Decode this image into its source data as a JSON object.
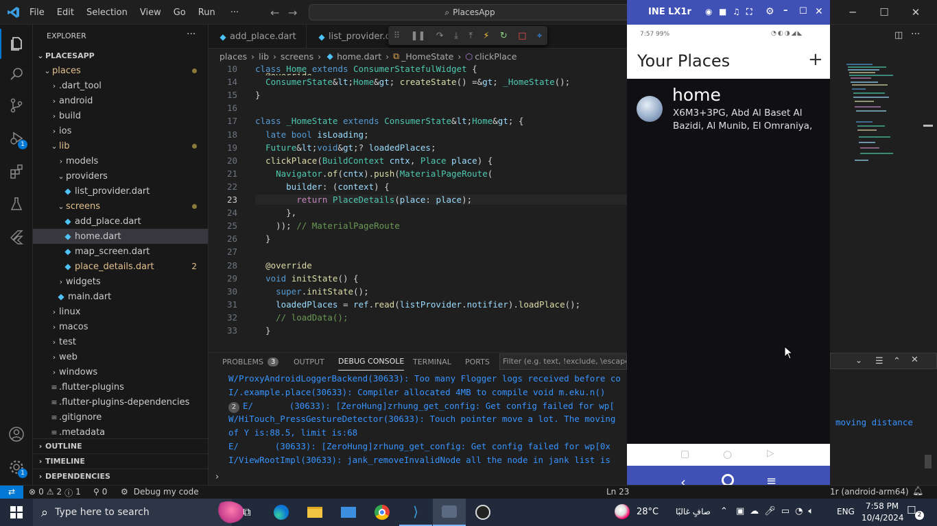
{
  "titlebar": {
    "menus": [
      "File",
      "Edit",
      "Selection",
      "View",
      "Go",
      "Run",
      "···"
    ],
    "search": "PlacesApp"
  },
  "explorer": {
    "title": "EXPLORER",
    "project": "PLACESAPP",
    "tree": [
      {
        "label": "places",
        "kind": "folder-open",
        "depth": 1,
        "color": "#e2c08d",
        "dot": true
      },
      {
        "label": ".dart_tool",
        "kind": "folder",
        "depth": 2
      },
      {
        "label": "android",
        "kind": "folder",
        "depth": 2
      },
      {
        "label": "build",
        "kind": "folder",
        "depth": 2
      },
      {
        "label": "ios",
        "kind": "folder",
        "depth": 2
      },
      {
        "label": "lib",
        "kind": "folder-open",
        "depth": 2,
        "color": "#e2c08d",
        "dot": true
      },
      {
        "label": "models",
        "kind": "folder",
        "depth": 3
      },
      {
        "label": "providers",
        "kind": "folder-open",
        "depth": 3
      },
      {
        "label": "list_provider.dart",
        "kind": "dart",
        "depth": 4
      },
      {
        "label": "screens",
        "kind": "folder-open",
        "depth": 3,
        "color": "#e2c08d",
        "dot": true
      },
      {
        "label": "add_place.dart",
        "kind": "dart",
        "depth": 4
      },
      {
        "label": "home.dart",
        "kind": "dart",
        "depth": 4,
        "selected": true
      },
      {
        "label": "map_screen.dart",
        "kind": "dart",
        "depth": 4
      },
      {
        "label": "place_details.dart",
        "kind": "dart",
        "depth": 4,
        "color": "#e2c08d",
        "badge": "2"
      },
      {
        "label": "widgets",
        "kind": "folder",
        "depth": 3
      },
      {
        "label": "main.dart",
        "kind": "dart",
        "depth": 3
      },
      {
        "label": "linux",
        "kind": "folder",
        "depth": 2
      },
      {
        "label": "macos",
        "kind": "folder",
        "depth": 2
      },
      {
        "label": "test",
        "kind": "folder",
        "depth": 2
      },
      {
        "label": "web",
        "kind": "folder",
        "depth": 2
      },
      {
        "label": "windows",
        "kind": "folder",
        "depth": 2
      },
      {
        "label": ".flutter-plugins",
        "kind": "file",
        "depth": 2
      },
      {
        "label": ".flutter-plugins-dependencies",
        "kind": "file",
        "depth": 2
      },
      {
        "label": ".gitignore",
        "kind": "file",
        "depth": 2
      },
      {
        "label": ".metadata",
        "kind": "file",
        "depth": 2
      }
    ],
    "sections": [
      "OUTLINE",
      "TIMELINE",
      "DEPENDENCIES"
    ]
  },
  "editor": {
    "tabs": [
      "add_place.dart",
      "list_provider.da"
    ],
    "breadcrumb": [
      "places",
      "lib",
      "screens",
      "home.dart",
      "_HomeState",
      "clickPlace"
    ],
    "current_line": "23",
    "lines": [
      {
        "n": "10",
        "t": "class Home extends ConsumerStatefulWidget {"
      },
      {
        "n": "14",
        "t": "  ConsumerState<Home> createState() => _HomeState();"
      },
      {
        "n": "15",
        "t": "}"
      },
      {
        "n": "16",
        "t": ""
      },
      {
        "n": "17",
        "t": "class _HomeState extends ConsumerState<Home> {"
      },
      {
        "n": "18",
        "t": "  late bool isLoading;"
      },
      {
        "n": "19",
        "t": "  Future<void>? loadedPlaces;"
      },
      {
        "n": "20",
        "t": "  clickPlace(BuildContext cntx, Place place) {"
      },
      {
        "n": "21",
        "t": "    Navigator.of(cntx).push(MaterialPageRoute("
      },
      {
        "n": "22",
        "t": "      builder: (context) {"
      },
      {
        "n": "23",
        "t": "        return PlaceDetails(place: place);"
      },
      {
        "n": "24",
        "t": "      },"
      },
      {
        "n": "25",
        "t": "    )); // MaterialPageRoute"
      },
      {
        "n": "26",
        "t": "  }"
      },
      {
        "n": "27",
        "t": ""
      },
      {
        "n": "28",
        "t": "  @override"
      },
      {
        "n": "29",
        "t": "  void initState() {"
      },
      {
        "n": "30",
        "t": "    super.initState();"
      },
      {
        "n": "31",
        "t": "    loadedPlaces = ref.read(listProvider.notifier).loadPlace();"
      },
      {
        "n": "32",
        "t": "    // loadData();"
      },
      {
        "n": "33",
        "t": "  }"
      }
    ],
    "sticky_override": "@override"
  },
  "panel": {
    "tabs": [
      "PROBLEMS",
      "OUTPUT",
      "DEBUG CONSOLE",
      "TERMINAL",
      "PORTS"
    ],
    "problems_count": "3",
    "active_tab": "DEBUG CONSOLE",
    "filter_placeholder": "Filter (e.g. text, !exclude, \\escape)",
    "log": [
      "W/ProxyAndroidLoggerBackend(30633): Too many Flogger logs received before co",
      "I/.example.place(30633): Compiler allocated 4MB to compile void m.eku.n()",
      "E/       (30633): [ZeroHung]zrhung_get_config: Get config failed for wp[",
      "W/HiTouch_PressGestureDetector(30633): Touch pointer move a lot. The moving",
      "of Y is:88.5, limit is:68",
      "E/       (30633): [ZeroHung]zrhung_get_config: Get config failed for wp[0x",
      "I/ViewRootImpl(30633): jank_removeInvalidNode all the node in jank list is"
    ],
    "log_repeat": "2",
    "right_overflow": "moving distance"
  },
  "phone": {
    "window_title": "INE LX1r",
    "status_time": "7:57",
    "status_battery": "99%",
    "app_title": "Your Places",
    "add_icon": "plus-icon",
    "places": [
      {
        "title": "home",
        "address": "X6M3+3PG, Abd Al Baset Al Bazidi, Al Munib, El Omraniya,"
      }
    ]
  },
  "statusbar": {
    "errors": "0",
    "warnings": "2",
    "info": "1",
    "ports": "0",
    "debug": "Debug my code",
    "position": "Ln 23",
    "device": "1r (android-arm64)"
  },
  "taskbar": {
    "search_placeholder": "Type here to search",
    "weather": "28°C",
    "weather_text": "صافٍ غالبًا",
    "lang": "ENG",
    "time": "7:58 PM",
    "date": "10/4/2024",
    "notifications": "2"
  },
  "colors": {
    "accent": "#3f51b5",
    "vscode_blue": "#0078d4",
    "modified": "#e2c08d"
  }
}
